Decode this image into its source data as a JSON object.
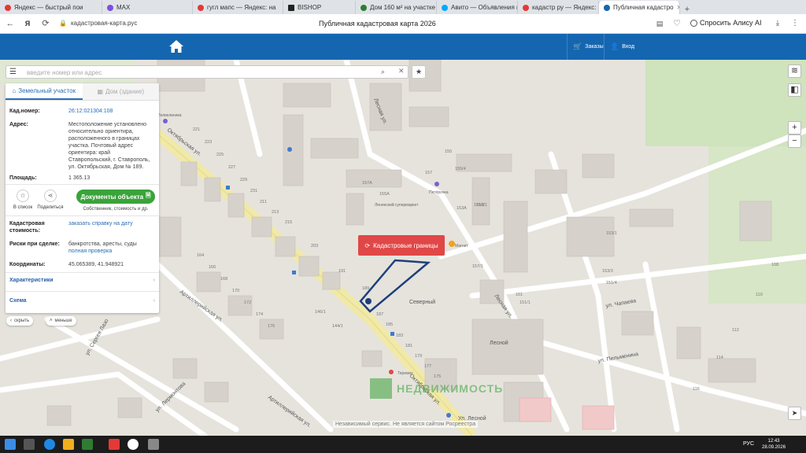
{
  "browser": {
    "tabs": [
      {
        "label": "Яндекс — быстрый пои",
        "icon": "yandex-icon",
        "color": "#e53935"
      },
      {
        "label": "MAX",
        "icon": "max-icon",
        "color": "#7b4fe0"
      },
      {
        "label": "гугл мапс — Яндекс: на",
        "icon": "yandex-icon",
        "color": "#e53935"
      },
      {
        "label": "BISHOP",
        "icon": "bishop-icon",
        "color": "#222222"
      },
      {
        "label": "Дом 160 м² на участке",
        "icon": "house-site-icon",
        "color": "#2e7d32"
      },
      {
        "label": "Авито — Объявления н",
        "icon": "avito-icon",
        "color": "#00aaff"
      },
      {
        "label": "кадастр ру — Яндекс: на",
        "icon": "yandex-icon",
        "color": "#e53935"
      },
      {
        "label": "Публичная кадастро",
        "icon": "cadastre-icon",
        "color": "#1566b0",
        "active": true
      }
    ],
    "url": "кадастровая-карта.рус",
    "page_title": "Публичная кадастровая карта 2026",
    "alice_label": "Спросить Алису AI"
  },
  "header": {
    "orders_label": "Заказы",
    "login_label": "Вход"
  },
  "search": {
    "placeholder": "введите номер или адрес"
  },
  "panel": {
    "tab_land": "Земельный участок",
    "tab_building": "Дом (здание)",
    "cad_number_label": "Кад.номер:",
    "cad_number": "26:12:021304:108",
    "address_label": "Адрес:",
    "address": "Местоположение установлено относительно ориентира, расположенного в границах участка. Почтовый адрес ориентира: край Ставропольский, г. Ставрополь, ул. Октябрьская, Дом № 189.",
    "area_label": "Площадь:",
    "area": "1 365.13",
    "save_label": "В список",
    "share_label": "Поделиться",
    "docs_button": "Документы объекта",
    "docs_sub": "Собственник, стоимость и др.",
    "cost_label": "Кадастровая стоимость:",
    "cost_link": "заказать справку на дату",
    "risks_label": "Риски при сделке:",
    "risks_text": "банкротства, аресты, суды",
    "risks_link": "полная проверка",
    "coords_label": "Координаты:",
    "coords": "45.065389, 41.948921",
    "characteristics": "Характеристики",
    "scheme": "Схема",
    "hide_label": "скрыть",
    "less_label": "меньше"
  },
  "map": {
    "cad_button": "Кадастровые границы",
    "labels": [
      {
        "text": "Октябрьская ул."
      },
      {
        "text": "Октябрьская ул."
      },
      {
        "text": "Северный"
      },
      {
        "text": "Лесной"
      },
      {
        "text": "Лесная ул."
      },
      {
        "text": "Лесная ул."
      },
      {
        "text": "Артиллерийская ул."
      },
      {
        "text": "Артиллерийская ул."
      },
      {
        "text": "ул. Сергея Лазо"
      },
      {
        "text": "ул. Пельменина"
      },
      {
        "text": "ул. Чапаева"
      },
      {
        "text": "ул. Лермонтова"
      },
      {
        "text": "Ул. Лесной"
      }
    ],
    "house_numbers": [
      "221",
      "223",
      "225",
      "227",
      "229",
      "231",
      "211",
      "213",
      "215",
      "203",
      "191",
      "189",
      "187",
      "185",
      "183",
      "181",
      "179",
      "177",
      "175",
      "164",
      "166",
      "168",
      "170",
      "172",
      "174",
      "176",
      "146/1",
      "144/1",
      "155",
      "157",
      "153/1",
      "153/3",
      "151",
      "151/1",
      "151/4",
      "153А",
      "155А",
      "157А",
      "151/2",
      "155/4",
      "157/1",
      "159/1",
      "108",
      "110",
      "112",
      "114",
      "116"
    ],
    "poi_labels": [
      "Поликлиника",
      "Ленинский супермаркет",
      "Пятёрочка",
      "Магнит",
      "Теремок"
    ]
  },
  "watermark": "НЕДВИЖИМОСТЬ",
  "notice": "Независимый сервис. Не является сайтом Росреестра",
  "taskbar": {
    "lang": "РУС",
    "time": "12:43",
    "date": "28.09.2026"
  },
  "colors": {
    "header_blue": "#1566b0",
    "parcel_outline": "#1f3f7a",
    "docs_green": "#3aa33a",
    "cad_red": "#e04747"
  }
}
